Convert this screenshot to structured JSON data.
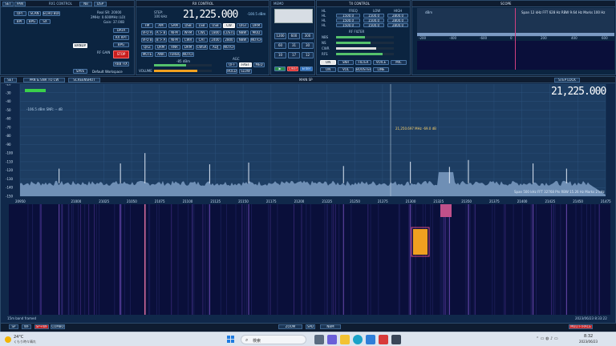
{
  "top": {
    "left_panel": {
      "tabs": [
        "SET",
        "PAN",
        "SDR",
        "NB",
        "DSP"
      ],
      "title": "RX1 CONTROL",
      "modes": [
        "OPT",
        "SCAN",
        "ECHO BUFF",
        "BPI",
        "BPG",
        "SX"
      ],
      "info": [
        "Real SR: 20000",
        "2MHz: 0.600MHz (LO)",
        "Gain: 37.00B"
      ],
      "buttons": [
        "DATA",
        "RX RPT",
        "BPG",
        "STOP",
        "RBB FIX",
        "BANDP",
        "SAVE"
      ],
      "rf_gain": "RF GAIN",
      "workspace": "Default Workspace",
      "stop": "STOP"
    },
    "rx_control": {
      "title": "RX CONTROL",
      "step_label": "STEP:",
      "step_value": "100 kHz",
      "freq": "21,225.000",
      "level": "-100.5 dBm",
      "vfo_label": "VFO",
      "row1": [
        "FM",
        "AM",
        "SAM",
        "DSB",
        "LSB",
        "USB",
        "CW",
        "DIGI",
        "DRM"
      ],
      "row2": [
        "VFO A",
        "A > B",
        "NFM",
        "WFM",
        "CWL",
        "1800",
        "CUSTOM",
        "NBW",
        "MOD"
      ],
      "row3": [
        "VFO B",
        "B > A",
        "NFM",
        "CWR",
        "CAT",
        "2400",
        "2800",
        "NBW",
        "NOTCH1"
      ],
      "row4": [
        "QRZ",
        "QRM",
        "RNR",
        "DRM",
        "CWSR",
        "ADJ",
        "NOTCH2"
      ],
      "row5": [
        "MUTE",
        "ANR",
        "TURBO",
        "NOTCH3"
      ],
      "sq_label": "-85 dBm",
      "volume": "VOLUME",
      "mute": "MUTE",
      "agc": "AGC",
      "agc_modes": [
        "OFF",
        "FAST",
        "MED",
        "SLOW"
      ],
      "hold": "HOLD"
    },
    "memo_panel": {
      "title": "MEMO",
      "keys": [
        "1",
        "2",
        "3",
        "4",
        "5",
        "6",
        "7",
        "8",
        "9",
        "0",
        "."
      ],
      "keypad_labels": [
        "1200",
        "600",
        "300",
        "60",
        "31",
        "30",
        "10",
        "17",
        "12",
        "Clear",
        "Enter"
      ]
    },
    "tx_control": {
      "title": "TX CONTROL",
      "rows": [
        {
          "label": "HL",
          "freq": "1500.0",
          "val": "2800.0"
        },
        {
          "label": "HL",
          "freq": "1500.0",
          "val": "2800.0"
        },
        {
          "label": "HL",
          "freq": "1500.0",
          "val": "2800.0"
        }
      ],
      "header": [
        "HL",
        "FREQ",
        "LOW",
        "HIGH"
      ],
      "rf_label": "RF FILTER",
      "sliders": [
        "NBS",
        "NS",
        "CWR",
        "RFS"
      ],
      "bottom": [
        "ON",
        "SNR",
        "FILTER",
        "VOICE",
        "MIC",
        "ON",
        "VOL",
        "BOOSTER",
        "LINE"
      ]
    },
    "scope": {
      "title": "SCOPE",
      "info": "Span 12 kHz  FFT 628 Hz  RBW 9.64 Hz  Marks 100 Hz",
      "ticks": [
        "-200",
        "-400",
        "-600",
        "0",
        "200",
        "400",
        "600"
      ],
      "level": "dBm"
    }
  },
  "main": {
    "toolbar": {
      "set": "SET",
      "pan_label": "PAN & SNR TO CW",
      "screen_label": "SCREENSHOT",
      "title": "MAIN SP",
      "step_label": "STEP LOCK"
    },
    "frequency_display": "21,225.000",
    "noise_floor": "-106.5 dBm  SNR: -- dB",
    "marker_label": "21,250.697 MHz  -69.0 dB",
    "y_ticks": [
      "-20",
      "-30",
      "-40",
      "-50",
      "-60",
      "-70",
      "-80",
      "-90",
      "-100",
      "-110",
      "-120",
      "-130",
      "-140",
      "-150"
    ],
    "x_ticks": [
      "20950",
      "21000",
      "21025",
      "21050",
      "21075",
      "21100",
      "21125",
      "21150",
      "21175",
      "21200",
      "21225",
      "21250",
      "21275",
      "21300",
      "21325",
      "21350",
      "21375",
      "21400",
      "21425",
      "21450",
      "21475"
    ],
    "span_info": "Span 500 kHz  FFT 32768 Pts  RBW 15.26 Hz  Marks 2 kHz",
    "date": "2023/06/23 8:33:22",
    "band": "15m band framed",
    "bottom_buttons": [
      "SP",
      "WF",
      "SP+WF",
      "COMBO"
    ],
    "zoom": "ZOOM",
    "spd": "SPD",
    "nbm": "NBM",
    "mode": "MULTI-TRACE"
  },
  "chart_data": {
    "type": "line",
    "title": "",
    "xlabel": "",
    "ylabel": "",
    "xlim": [
      20950,
      21475
    ],
    "ylim": [
      -150,
      -20
    ],
    "signals": [
      {
        "x": 20985,
        "y": -118
      },
      {
        "x": 21040,
        "y": -112
      },
      {
        "x": 21062,
        "y": -100
      },
      {
        "x": 21120,
        "y": -113
      },
      {
        "x": 21155,
        "y": -111
      },
      {
        "x": 21240,
        "y": -115
      },
      {
        "x": 21300,
        "y": -110
      },
      {
        "x": 21335,
        "y": -116
      },
      {
        "x": 21352,
        "y": -108
      },
      {
        "x": 21410,
        "y": -112
      },
      {
        "x": 21440,
        "y": -118
      }
    ],
    "floor": -135
  },
  "taskbar": {
    "weather_temp": "24°C",
    "weather_desc": "くもり時々晴れ",
    "search": "検索",
    "time": "8:32",
    "date": "2023/06/23"
  },
  "colors": {
    "bg": "#0c1a2e",
    "spectrum_fill": "#6f8fb5",
    "accent": "#c81e1e",
    "waterfall": "#0a0f3a"
  }
}
